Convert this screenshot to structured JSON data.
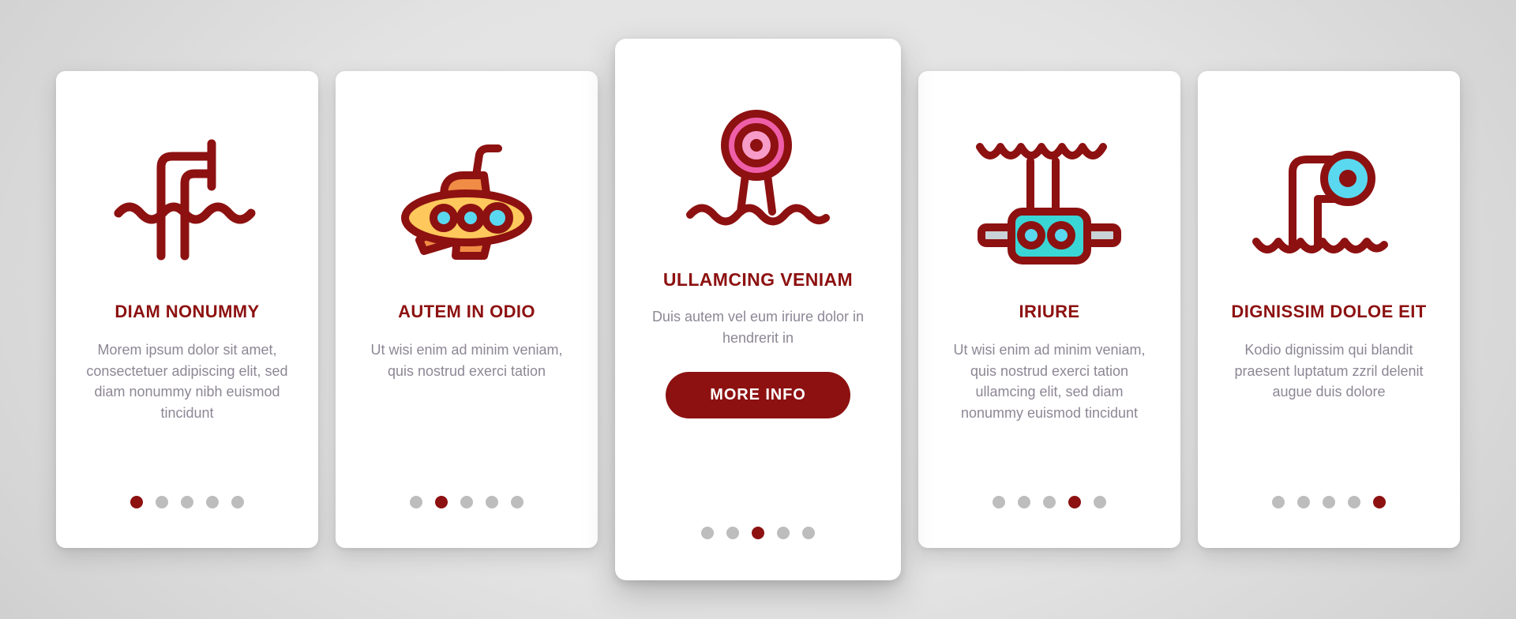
{
  "screen": {
    "kind": "onboarding-carousel",
    "background_color": "#e3e3e3",
    "accent_color": "#8d1111",
    "body_text_color": "#8d8795",
    "dot_inactive_color": "#bdbdbd",
    "card_background": "#ffffff"
  },
  "cards": [
    {
      "icon_name": "periscope-waves-icon",
      "title": "DIAM NONUMMY",
      "body": "Morem ipsum dolor sit amet, consectetuer adipiscing elit, sed diam nonummy nibh euismod tincidunt",
      "featured": false,
      "dots_total": 5,
      "dot_active_index": 0,
      "icon_colors": {
        "stroke": "#8d1111"
      }
    },
    {
      "icon_name": "submarine-icon",
      "title": "AUTEM IN ODIO",
      "body": "Ut wisi enim ad minim veniam, quis nostrud exerci tation",
      "featured": false,
      "dots_total": 5,
      "dot_active_index": 1,
      "icon_colors": {
        "stroke": "#8d1111",
        "body": "#ffc85c",
        "fin": "#f08c46",
        "porthole": "#5ad8f0"
      }
    },
    {
      "icon_name": "buoy-marker-waves-icon",
      "title": "ULLAMCING VENIAM",
      "body": "Duis autem vel eum iriure dolor in hendrerit in",
      "featured": true,
      "button_label": "MORE INFO",
      "dots_total": 5,
      "dot_active_index": 2,
      "icon_colors": {
        "stroke": "#8d1111",
        "ring_outer": "#ef5fa8",
        "ring_inner": "#f79cc8"
      }
    },
    {
      "icon_name": "underwater-drone-icon",
      "title": "IRIURE",
      "body": "Ut wisi enim ad minim veniam, quis nostrud exerci tation ullamcing elit, sed diam nonummy euismod tincidunt",
      "featured": false,
      "dots_total": 5,
      "dot_active_index": 3,
      "icon_colors": {
        "stroke": "#8d1111",
        "body": "#3ad6d6",
        "arm": "#c9d2d6",
        "porthole": "#5ad8f0"
      }
    },
    {
      "icon_name": "periscope-lens-waves-icon",
      "title": "DIGNISSIM DOLOE EIT",
      "body": "Kodio dignissim qui blandit praesent luptatum zzril delenit augue duis dolore",
      "featured": false,
      "dots_total": 5,
      "dot_active_index": 4,
      "icon_colors": {
        "stroke": "#8d1111",
        "lens": "#5ad8f0"
      }
    }
  ]
}
